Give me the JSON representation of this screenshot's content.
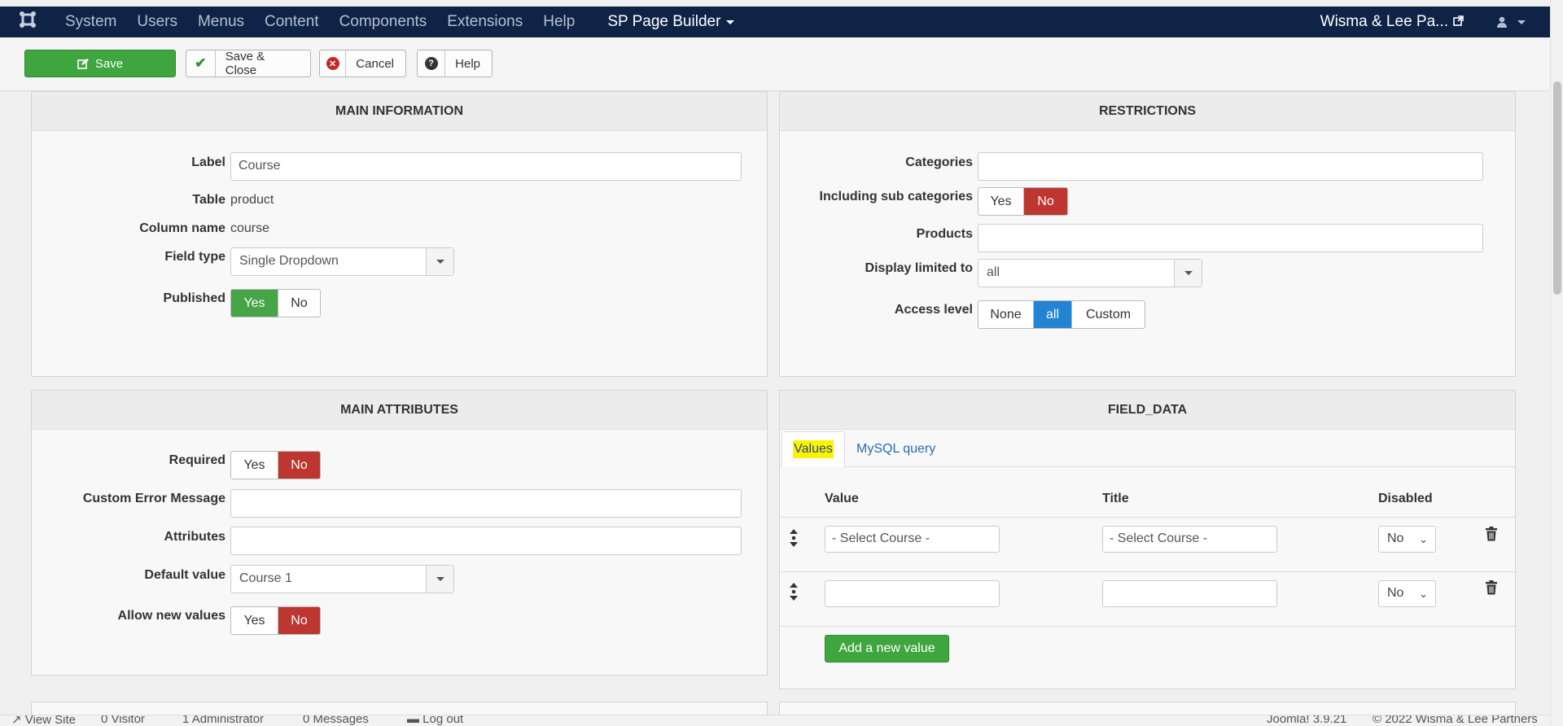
{
  "navbar": {
    "menu": [
      "System",
      "Users",
      "Menus",
      "Content",
      "Components",
      "Extensions",
      "Help"
    ],
    "sp_page_builder": "SP Page Builder",
    "site_name": "Wisma & Lee Pa..."
  },
  "toolbar": {
    "save": "Save",
    "save_close": "Save & Close",
    "cancel": "Cancel",
    "help": "Help"
  },
  "main_information": {
    "title": "MAIN INFORMATION",
    "label_label": "Label",
    "label_value": "Course",
    "table_label": "Table",
    "table_value": "product",
    "column_label": "Column name",
    "column_value": "course",
    "field_type_label": "Field type",
    "field_type_value": "Single Dropdown",
    "published_label": "Published",
    "yes": "Yes",
    "no": "No"
  },
  "restrictions": {
    "title": "RESTRICTIONS",
    "categories_label": "Categories",
    "sub_categories_label": "Including sub categories",
    "products_label": "Products",
    "display_limited_label": "Display limited to",
    "display_limited_value": "all",
    "access_level_label": "Access level",
    "access_none": "None",
    "access_all": "all",
    "access_custom": "Custom",
    "yes": "Yes",
    "no": "No"
  },
  "main_attributes": {
    "title": "MAIN ATTRIBUTES",
    "required_label": "Required",
    "custom_error_label": "Custom Error Message",
    "attributes_label": "Attributes",
    "default_value_label": "Default value",
    "default_value": "Course 1",
    "allow_new_label": "Allow new values",
    "yes": "Yes",
    "no": "No"
  },
  "field_data": {
    "title": "FIELD_DATA",
    "tab_values": "Values",
    "tab_mysql": "MySQL query",
    "col_value": "Value",
    "col_title": "Title",
    "col_disabled": "Disabled",
    "rows": [
      {
        "value": "- Select Course -",
        "title": "- Select Course -",
        "disabled": "No"
      },
      {
        "value": "",
        "title": "",
        "disabled": "No"
      }
    ],
    "add_button": "Add a new value"
  },
  "footer": {
    "view_site": "View Site",
    "visitor_count": "0",
    "visitor": "Visitor",
    "admin_count": "1",
    "administrator": "Administrator",
    "messages_count": "0",
    "messages": "Messages",
    "logout": "Log out",
    "version": "Joomla! 3.9.21",
    "copyright": "© 2022 Wisma & Lee Partners"
  }
}
